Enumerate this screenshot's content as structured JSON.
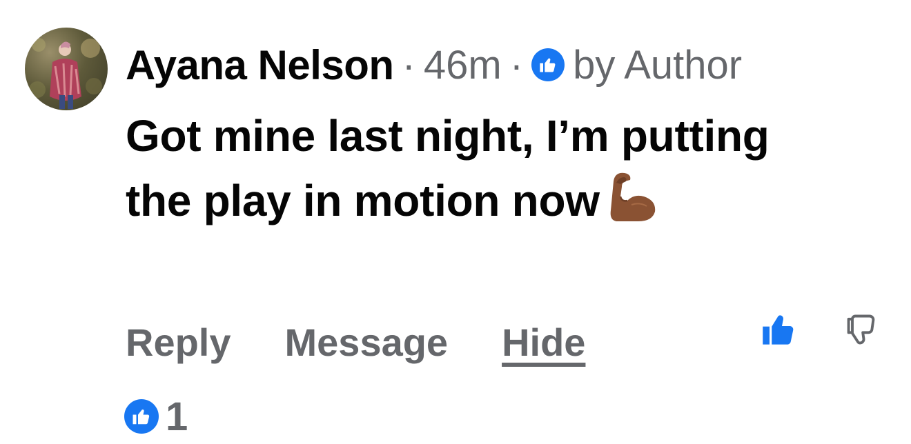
{
  "comment": {
    "author_name": "Ayana Nelson",
    "time_ago": "46m",
    "separator": "·",
    "liked_by_label": "by Author",
    "text": "Got mine last night, I’m putting the play in motion now",
    "emoji_icon": "flexed-biceps-icon"
  },
  "actions": {
    "reply_label": "Reply",
    "message_label": "Message",
    "hide_label": "Hide"
  },
  "reactions": {
    "like_count": "1"
  },
  "colors": {
    "text_primary": "#050505",
    "text_secondary": "#65676b",
    "like_blue": "#1877f2",
    "background": "#ffffff"
  },
  "icons": {
    "avatar": "avatar",
    "liked_by_author": "thumbs-up-icon",
    "like_vote": "thumbs-up-icon",
    "dislike_vote": "thumbs-down-icon"
  }
}
